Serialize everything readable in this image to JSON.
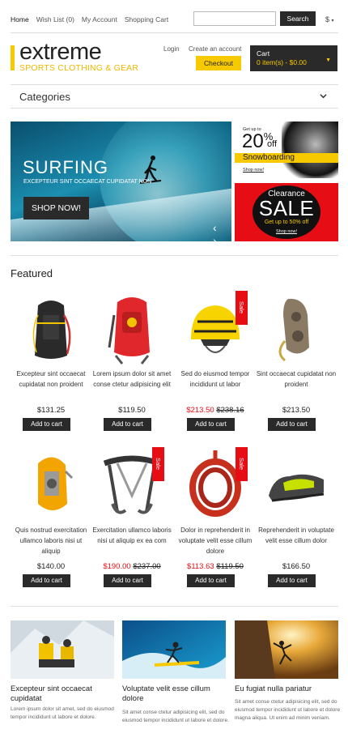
{
  "topnav": {
    "home": "Home",
    "wishlist": "Wish List (0)",
    "account": "My Account",
    "cart": "Shopping Cart"
  },
  "search": {
    "button": "Search",
    "placeholder": ""
  },
  "currency": "$",
  "logo": {
    "name": "extreme",
    "tagline": "SPORTS CLOTHING & GEAR"
  },
  "account": {
    "login": "Login",
    "create": "Create an account",
    "checkout": "Checkout"
  },
  "cart": {
    "label": "Cart",
    "summary": "0 item(s) - $0.00"
  },
  "categories": "Categories",
  "banner": {
    "title": "SURFING",
    "subtitle": "EXCEPTEUR SINT OCCAECAT CUPIDATAT NON",
    "button": "SHOP NOW!"
  },
  "promo1": {
    "getup": "Get up to",
    "amount": "20",
    "unit": "%",
    "off": "off",
    "category": "Snowboarding",
    "link": "Shop now!"
  },
  "promo2": {
    "clearance": "Clearance",
    "sale": "SALE",
    "upto": "Get up to 50% off",
    "link": "Shop now!"
  },
  "featured_title": "Featured",
  "products": [
    {
      "name": "Excepteur sint occaecat cupidatat non proident",
      "price": "$131.25",
      "sale": false,
      "img": "backpack"
    },
    {
      "name": "Lorem ipsum dolor sit amet conse ctetur adipisicing elit",
      "price": "$119.50",
      "sale": false,
      "img": "red-backpack"
    },
    {
      "name": "Sed do eiusmod tempor incididunt ut labor",
      "price_new": "$213.50",
      "price_old": "$238.16",
      "sale": true,
      "img": "helmet"
    },
    {
      "name": "Sint occaecat cupidatat non proident",
      "price": "$213.50",
      "sale": false,
      "img": "belay-device"
    },
    {
      "name": "Quis nostrud exercitation ullamco laboris nisi ut aliquip",
      "price": "$140.00",
      "sale": false,
      "img": "yellow-belay"
    },
    {
      "name": "Exercitation ullamco laboris nisi ut aliquip ex ea com",
      "price_new": "$190.00",
      "price_old": "$237.00",
      "sale": true,
      "img": "harness"
    },
    {
      "name": "Dolor in reprehenderit in voluptate velit esse cillum dolore",
      "price_new": "$113.63",
      "price_old": "$119.50",
      "sale": true,
      "img": "rope"
    },
    {
      "name": "Reprehenderit in voluptate velit esse cillum dolor",
      "price": "$166.50",
      "sale": false,
      "img": "climbing-shoe"
    }
  ],
  "labels": {
    "add_to_cart": "Add to cart",
    "sale": "Sale"
  },
  "posts": [
    {
      "title": "Excepteur sint occaecat cupidatat",
      "text": "Lorem ipsum dolor sit amet, sed do eiusmod tempor incididunt ut labore et dolore."
    },
    {
      "title": "Voluptate velit esse cillum dolore",
      "text": "Sit amet conse ctetur adipisicing elit, sed do eiusmod tempor incididunt ut labore et dolore."
    },
    {
      "title": "Eu fugiat nulla pariatur",
      "text": "Sit amet conse ctetur adipisicing elit, sed do eiusmod tempor incididunt ut labore et dolore magna aliqua. Ut enim ad minim veniam."
    }
  ]
}
